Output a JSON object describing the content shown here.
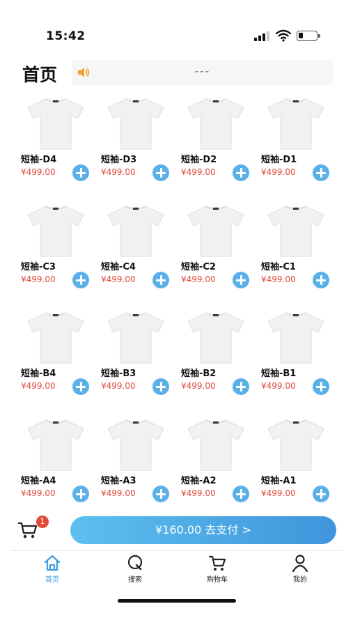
{
  "status_bar": {
    "time": "15:42"
  },
  "header": {
    "title": "首页",
    "notice": "---"
  },
  "products": [
    {
      "name": "短袖-D4",
      "price": "¥499.00"
    },
    {
      "name": "短袖-D3",
      "price": "¥499.00"
    },
    {
      "name": "短袖-D2",
      "price": "¥499.00"
    },
    {
      "name": "短袖-D1",
      "price": "¥499.00"
    },
    {
      "name": "短袖-C3",
      "price": "¥499.00"
    },
    {
      "name": "短袖-C4",
      "price": "¥499.00"
    },
    {
      "name": "短袖-C2",
      "price": "¥499.00"
    },
    {
      "name": "短袖-C1",
      "price": "¥499.00"
    },
    {
      "name": "短袖-B4",
      "price": "¥499.00"
    },
    {
      "name": "短袖-B3",
      "price": "¥499.00"
    },
    {
      "name": "短袖-B2",
      "price": "¥499.00"
    },
    {
      "name": "短袖-B1",
      "price": "¥499.00"
    },
    {
      "name": "短袖-A4",
      "price": "¥499.00"
    },
    {
      "name": "短袖-A3",
      "price": "¥499.00"
    },
    {
      "name": "短袖-A2",
      "price": "¥499.00"
    },
    {
      "name": "短袖-A1",
      "price": "¥499.00"
    }
  ],
  "cart": {
    "badge_count": "1",
    "pay_label": "¥160.00 去支付 >"
  },
  "tabs": [
    {
      "label": "首页",
      "icon": "home-icon",
      "active": true
    },
    {
      "label": "搜索",
      "icon": "search-icon",
      "active": false
    },
    {
      "label": "购物车",
      "icon": "cart-icon",
      "active": false
    },
    {
      "label": "我的",
      "icon": "user-icon",
      "active": false
    }
  ],
  "colors": {
    "accent": "#3b9ee0",
    "price": "#e04a3c",
    "badge": "#e34b3b",
    "add_button": "#5bb0e8",
    "notice_icon": "#f0a030"
  }
}
